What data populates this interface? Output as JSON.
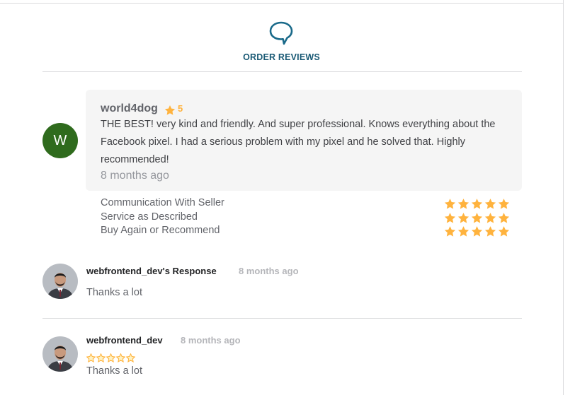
{
  "header": {
    "title": "ORDER REVIEWS",
    "icon": "speech-bubble-icon",
    "accent_color": "#1a5a75"
  },
  "review": {
    "avatar_letter": "W",
    "avatar_color": "#2f6b1d",
    "username": "world4dog",
    "rating": "5",
    "text": "THE BEST! very kind and friendly. And super professional. Knows everything about the Facebook pixel. I had a serious problem with my pixel and he solved that. Highly recommended!",
    "time": "8 months ago",
    "breakdown": [
      {
        "label": "Communication With Seller",
        "stars": 5
      },
      {
        "label": "Service as Described",
        "stars": 5
      },
      {
        "label": "Buy Again or Recommend",
        "stars": 5
      }
    ],
    "star_color": "#ffb33e"
  },
  "response": {
    "name": "webfrontend_dev's Response",
    "time": "8 months ago",
    "text": "Thanks a lot"
  },
  "review2": {
    "name": "webfrontend_dev",
    "time": "8 months ago",
    "stars": 5,
    "text": "Thanks a lot"
  }
}
